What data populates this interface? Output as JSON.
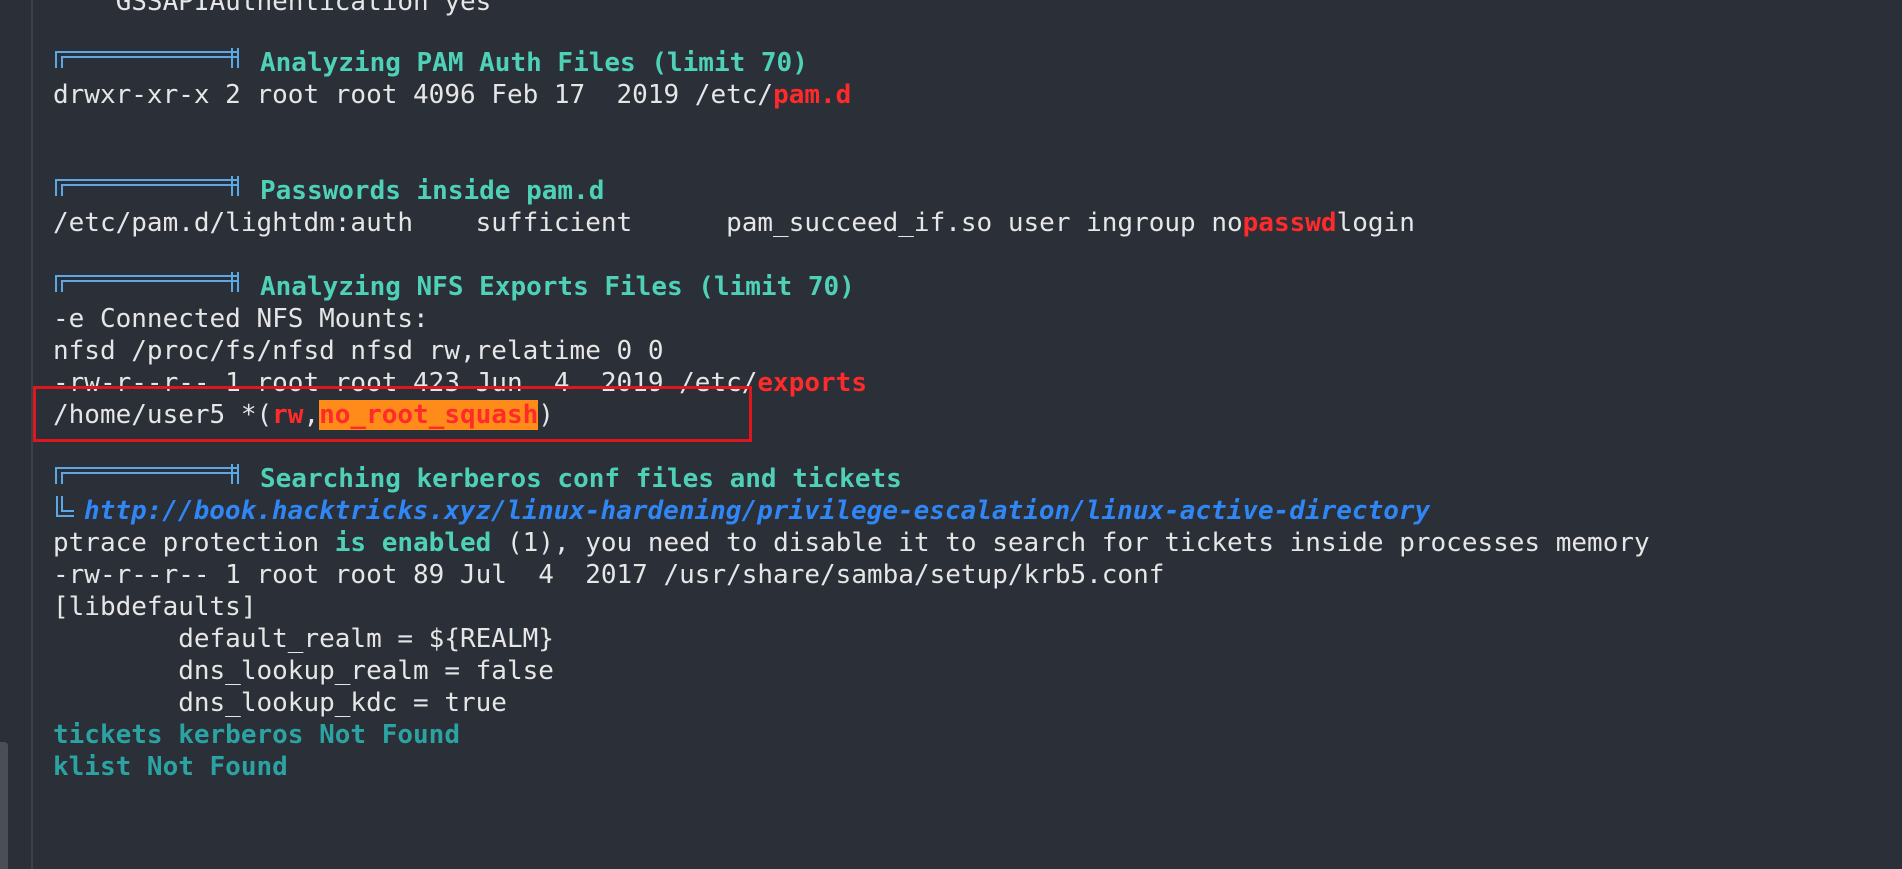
{
  "terminal": {
    "lines": {
      "gssapi": "    GSSAPIAuthentication yes",
      "pam_header": "Analyzing PAM Auth Files (limit 70)",
      "pam_dir_prefix": "drwxr-xr-x 2 root root 4096 Feb 17  2019 /etc/",
      "pam_dir_name": "pam.d",
      "pw_header": "Passwords inside pam.d",
      "pw_line_prefix": "/etc/pam.d/lightdm:auth    sufficient      pam_succeed_if.so user ingroup no",
      "pw_line_match": "passwd",
      "pw_line_suffix": "login",
      "nfs_header": "Analyzing NFS Exports Files (limit 70)",
      "nfs_mounts": "-e Connected NFS Mounts:",
      "nfsd_line": "nfsd /proc/fs/nfsd nfsd rw,relatime 0 0",
      "exports_prefix": "-rw-r--r-- 1 root root 423 Jun  4  2019 /etc/",
      "exports_name": "exports",
      "export_path": "/home/user5 *(",
      "export_rw": "rw",
      "export_comma": ",",
      "export_squash": "no_root_squash",
      "export_close": ")",
      "krb_header": "Searching kerberos conf files and tickets",
      "krb_link": "http://book.hacktricks.xyz/linux-hardening/privilege-escalation/linux-active-directory",
      "ptrace_prefix": "ptrace protection ",
      "ptrace_enabled": "is enabled",
      "ptrace_suffix": " (1), you need to disable it to search for tickets inside processes memory",
      "krb5_file": "-rw-r--r-- 1 root root 89 Jul  4  2017 /usr/share/samba/setup/krb5.conf",
      "libdefaults": "[libdefaults]",
      "default_realm": "        default_realm = ${REALM}",
      "dns_lookup_realm": "        dns_lookup_realm = false",
      "dns_lookup_kdc": "        dns_lookup_kdc = true",
      "tickets_not_found": "tickets kerberos Not Found",
      "klist_not_found": "klist Not Found"
    }
  },
  "icons": {
    "section": "section-bracket-icon",
    "corner": "corner-bracket-icon"
  },
  "colors": {
    "background": "#2b2f38",
    "text": "#e6e6e6",
    "header": "#4fd1b8",
    "match_red": "#ff2a2a",
    "highlight": "#ff8c1a",
    "link_blue": "#2f86f5",
    "teal": "#2ba3a3",
    "annotation_box": "#e0161e"
  }
}
